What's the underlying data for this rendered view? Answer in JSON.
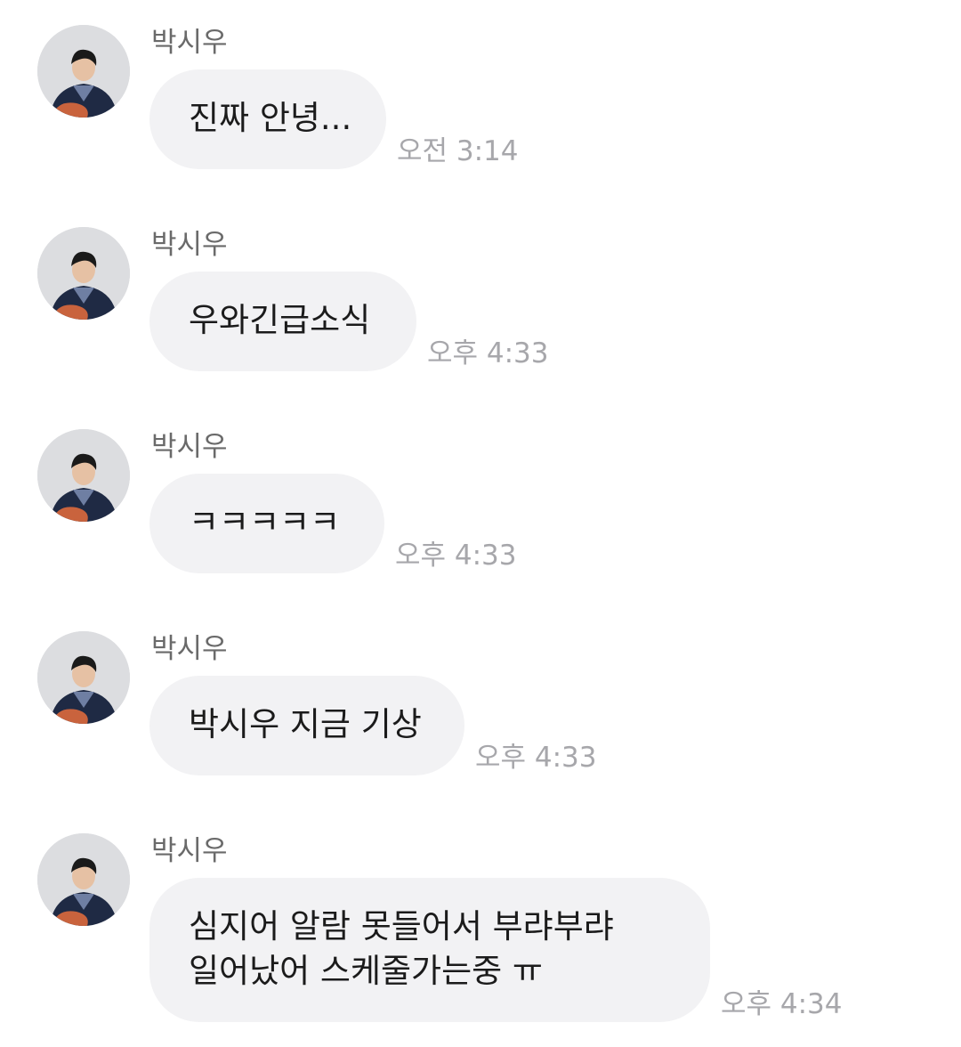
{
  "messages": [
    {
      "sender": "박시우",
      "lines": [
        "진짜 안녕..."
      ],
      "time": "오전 3:14"
    },
    {
      "sender": "박시우",
      "lines": [
        "우와긴급소식"
      ],
      "time": "오후 4:33"
    },
    {
      "sender": "박시우",
      "lines": [
        "ㅋㅋㅋㅋㅋ"
      ],
      "time": "오후 4:33"
    },
    {
      "sender": "박시우",
      "lines": [
        "박시우 지금 기상"
      ],
      "time": "오후 4:33"
    },
    {
      "sender": "박시우",
      "lines": [
        "심지어 알람 못들어서 부랴부랴",
        "일어났어 스케줄가는중 ㅠ"
      ],
      "time": "오후 4:34"
    }
  ],
  "colors": {
    "bubble": "#f2f2f4",
    "text": "#1b1b1b",
    "sender": "#6a6a6a",
    "time": "#a7a7ab"
  },
  "icons": {
    "avatar": "profile-photo"
  }
}
